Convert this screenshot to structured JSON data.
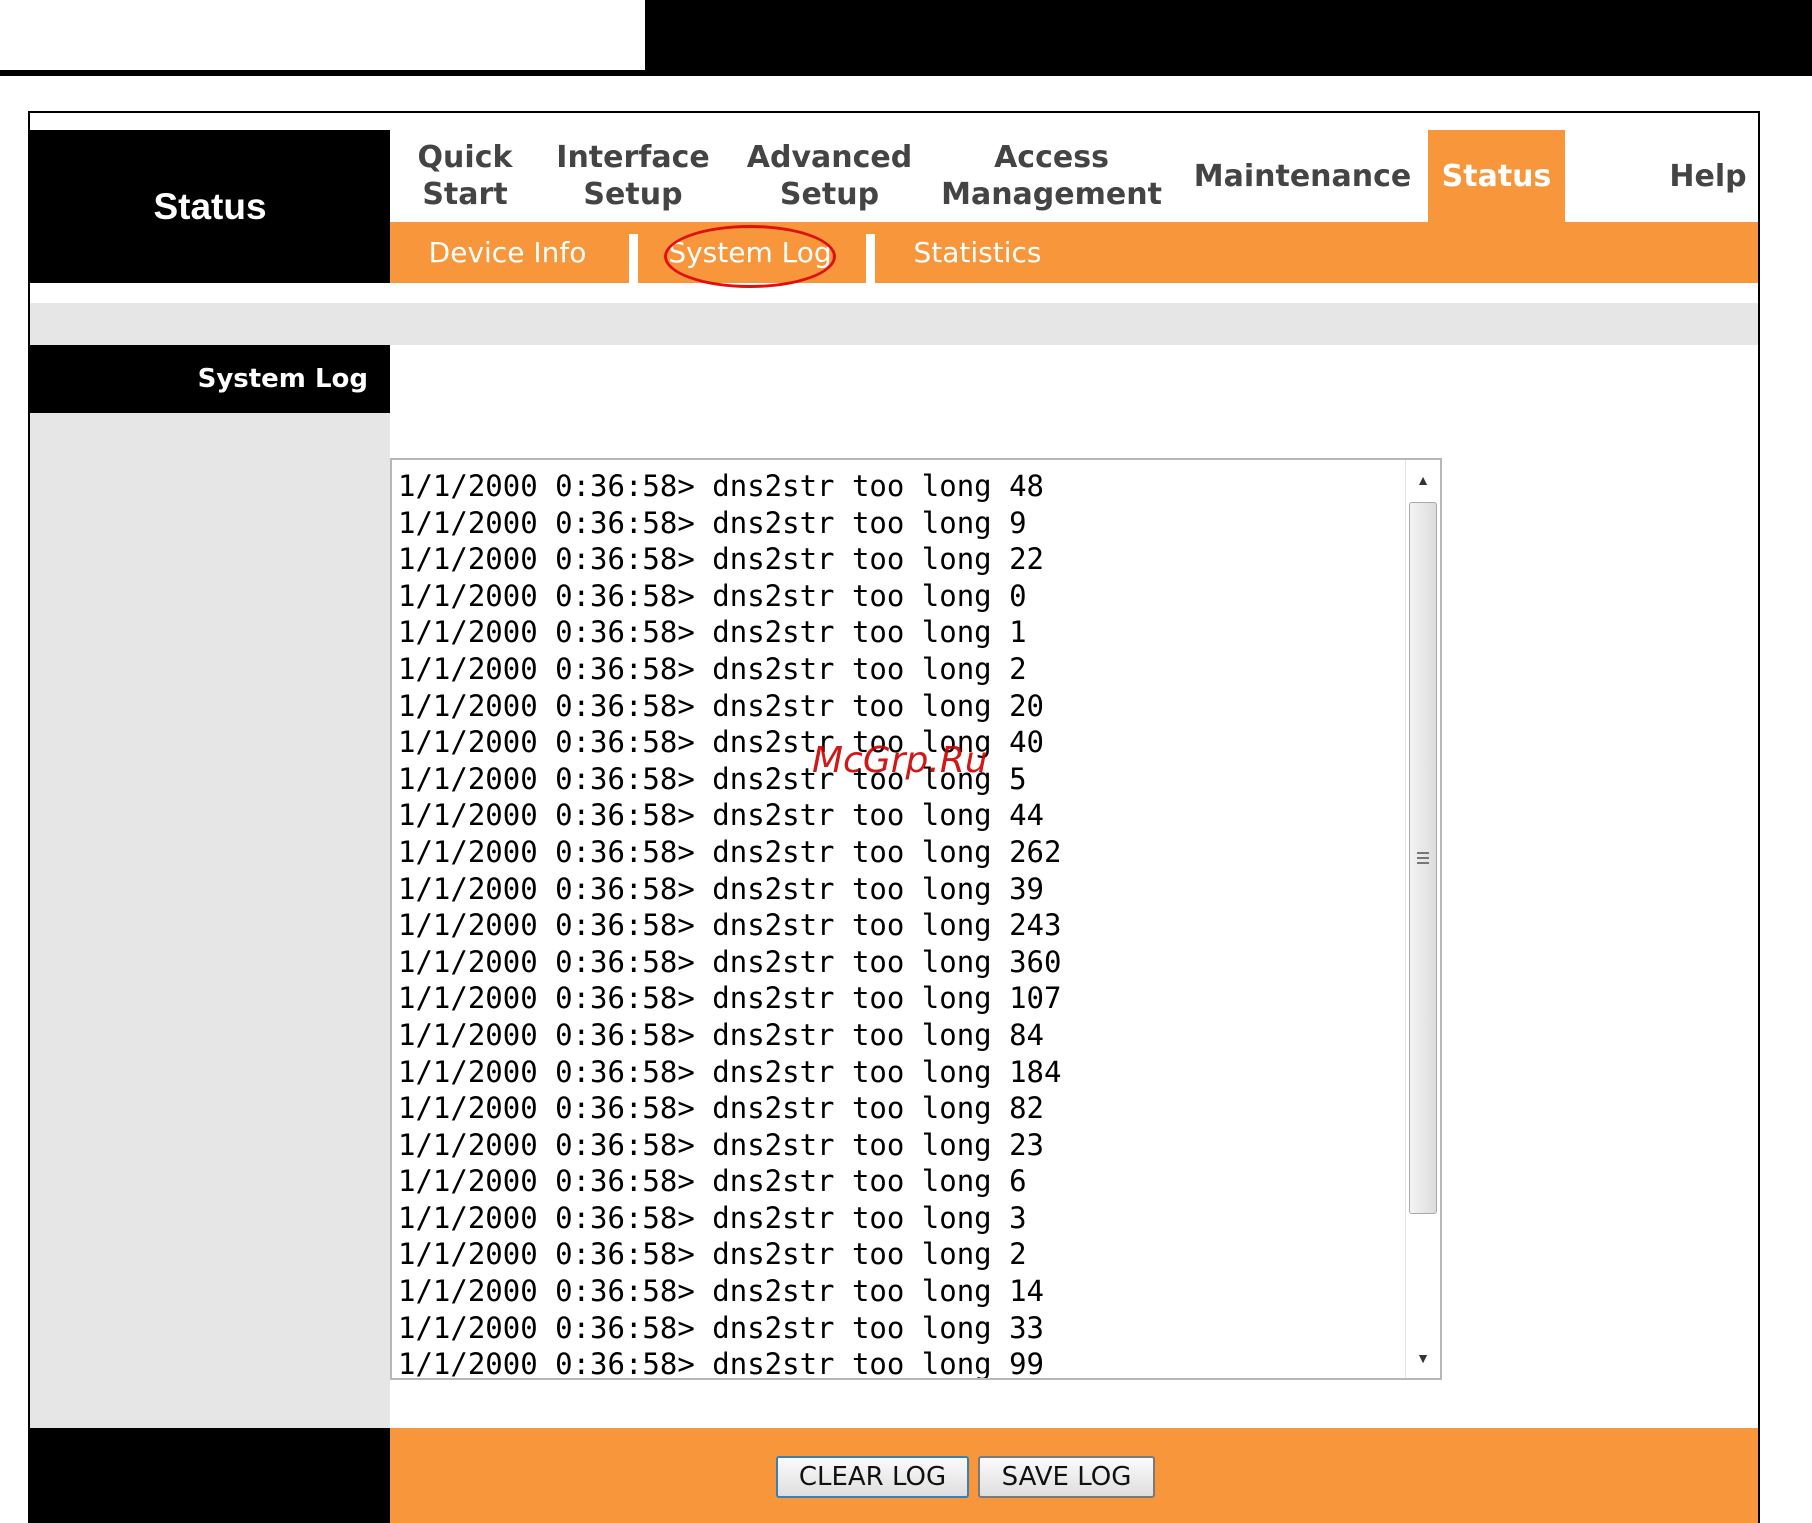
{
  "section_title": "Status",
  "nav": {
    "quick_start": [
      "Quick",
      "Start"
    ],
    "interface_setup": [
      "Interface",
      "Setup"
    ],
    "advanced_setup": [
      "Advanced",
      "Setup"
    ],
    "access_management": [
      "Access",
      "Management"
    ],
    "maintenance": "Maintenance",
    "status": "Status",
    "help": "Help"
  },
  "subnav": {
    "device_info": "Device Info",
    "system_log": "System Log",
    "statistics": "Statistics"
  },
  "sidebar_label": "System Log",
  "log_lines": [
    "1/1/2000 0:36:58> dns2str too long 48",
    "1/1/2000 0:36:58> dns2str too long 9",
    "1/1/2000 0:36:58> dns2str too long 22",
    "1/1/2000 0:36:58> dns2str too long 0",
    "1/1/2000 0:36:58> dns2str too long 1",
    "1/1/2000 0:36:58> dns2str too long 2",
    "1/1/2000 0:36:58> dns2str too long 20",
    "1/1/2000 0:36:58> dns2str too long 40",
    "1/1/2000 0:36:58> dns2str too long 5",
    "1/1/2000 0:36:58> dns2str too long 44",
    "1/1/2000 0:36:58> dns2str too long 262",
    "1/1/2000 0:36:58> dns2str too long 39",
    "1/1/2000 0:36:58> dns2str too long 243",
    "1/1/2000 0:36:58> dns2str too long 360",
    "1/1/2000 0:36:58> dns2str too long 107",
    "1/1/2000 0:36:58> dns2str too long 84",
    "1/1/2000 0:36:58> dns2str too long 184",
    "1/1/2000 0:36:58> dns2str too long 82",
    "1/1/2000 0:36:58> dns2str too long 23",
    "1/1/2000 0:36:58> dns2str too long 6",
    "1/1/2000 0:36:58> dns2str too long 3",
    "1/1/2000 0:36:58> dns2str too long 2",
    "1/1/2000 0:36:58> dns2str too long 14",
    "1/1/2000 0:36:58> dns2str too long 33",
    "1/1/2000 0:36:58> dns2str too long 99"
  ],
  "watermark": "McGrp.Ru",
  "buttons": {
    "clear_log": "CLEAR LOG",
    "save_log": "SAVE LOG"
  },
  "icons": {
    "scroll_up": "scroll-up-arrow-icon",
    "scroll_down": "scroll-down-arrow-icon",
    "scroll_grip": "scroll-grip-icon"
  },
  "colors": {
    "accent_orange": "#f7963a",
    "header_black": "#000000",
    "panel_gray": "#e6e6e6",
    "highlight_ring": "#e01010"
  }
}
